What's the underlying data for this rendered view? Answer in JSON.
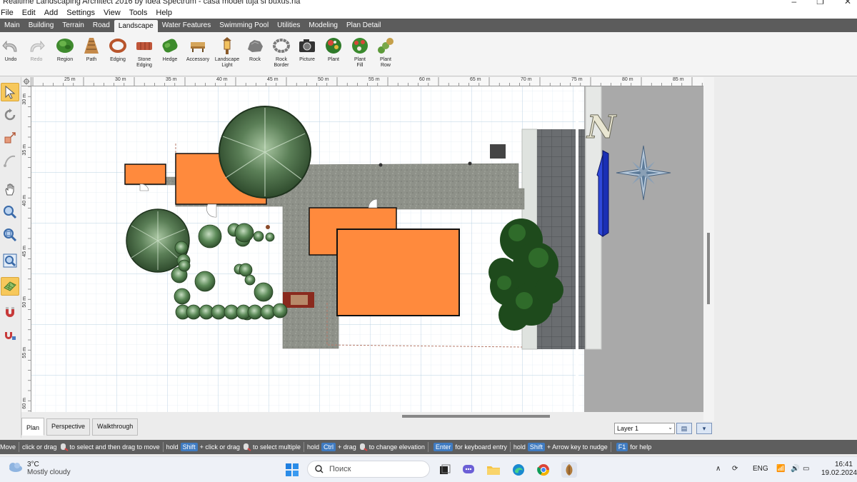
{
  "window": {
    "title": "Realtime Landscaping Architect 2016 by Idea Spectrum - casa model tuja si buxus.rla",
    "controls": [
      "minimize-icon",
      "restore-icon",
      "close-icon"
    ]
  },
  "menu": [
    "File",
    "Edit",
    "Add",
    "Settings",
    "View",
    "Tools",
    "Help"
  ],
  "tabs": [
    {
      "label": "Main"
    },
    {
      "label": "Building"
    },
    {
      "label": "Terrain"
    },
    {
      "label": "Road"
    },
    {
      "label": "Landscape",
      "active": true
    },
    {
      "label": "Water Features"
    },
    {
      "label": "Swimming Pool"
    },
    {
      "label": "Utilities"
    },
    {
      "label": "Modeling"
    },
    {
      "label": "Plan Detail"
    }
  ],
  "ribbon": {
    "undo": "Undo",
    "redo": "Redo",
    "region": "Region",
    "path": "Path",
    "edging": "Edging",
    "stone_edging_1": "Stone",
    "stone_edging_2": "Edging",
    "hedge": "Hedge",
    "accessory": "Accessory",
    "light_1": "Landscape",
    "light_2": "Light",
    "rock": "Rock",
    "rock_border_1": "Rock",
    "rock_border_2": "Border",
    "picture": "Picture",
    "plant": "Plant",
    "plant_fill_1": "Plant",
    "plant_fill_2": "Fill",
    "plant_row_1": "Plant",
    "plant_row_2": "Row"
  },
  "ruler": {
    "top": [
      "25 m",
      "30 m",
      "35 m",
      "40 m",
      "45 m",
      "50 m",
      "55 m",
      "60 m",
      "65 m",
      "70 m",
      "75 m",
      "80 m",
      "85 m"
    ],
    "left": [
      "30 m",
      "35 m",
      "40 m",
      "45 m",
      "50 m",
      "55 m",
      "60 m"
    ]
  },
  "plan": {
    "compass_letter": "N"
  },
  "view_tabs": [
    {
      "label": "Plan",
      "active": true
    },
    {
      "label": "Perspective"
    },
    {
      "label": "Walkthrough"
    }
  ],
  "layer": "Layer 1",
  "status": {
    "mode": "Move",
    "t1": "click or drag",
    "t2": "to select and then drag to move",
    "hold1": "hold",
    "k_shift": "Shift",
    "t3": "+ click or drag",
    "t4": "to select multiple",
    "hold2": "hold",
    "k_ctrl": "Ctrl",
    "t5": "+ drag",
    "t6": "to change elevation",
    "k_enter": "Enter",
    "t7": "for keyboard entry",
    "hold3": "hold",
    "k_shift2": "Shift",
    "t8": "+ Arrow key to nudge",
    "k_f1": "F1",
    "t9": "for help"
  },
  "taskbar": {
    "temp": "3°C",
    "condition": "Mostly cloudy",
    "search_placeholder": "Поиск",
    "lang": "ENG",
    "time": "16:41",
    "date": "19.02.2024"
  },
  "colors": {
    "house": "#ff8a3d",
    "paving": "#8e9189",
    "tab_bar": "#5c5c5c",
    "status_key": "#3f7bc1",
    "road": "#a9a9a9"
  }
}
